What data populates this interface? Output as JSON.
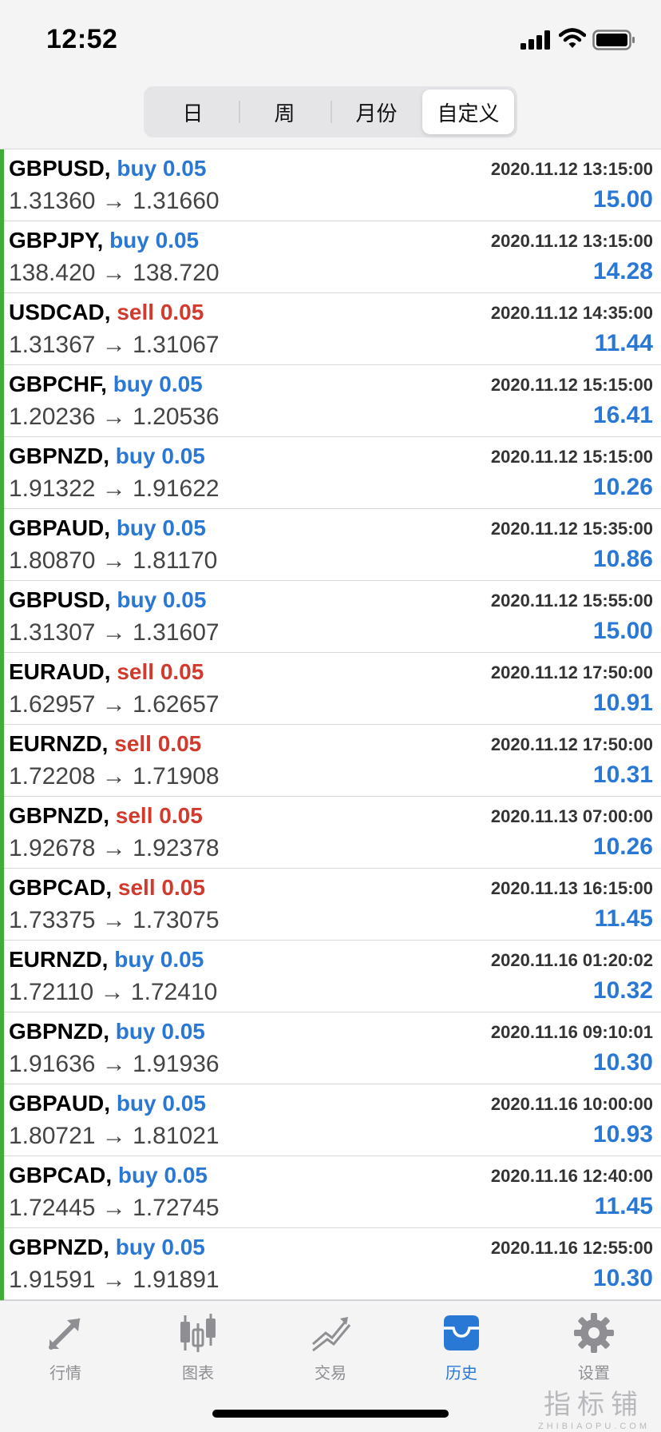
{
  "status": {
    "time": "12:52"
  },
  "segments": [
    {
      "label": "日",
      "active": false
    },
    {
      "label": "周",
      "active": false
    },
    {
      "label": "月份",
      "active": false
    },
    {
      "label": "自定义",
      "active": true
    }
  ],
  "trades": [
    {
      "symbol": "GBPUSD,",
      "side": "buy",
      "volume": "0.05",
      "open": "1.31360",
      "close": "1.31660",
      "time": "2020.11.12 13:15:00",
      "profit": "15.00"
    },
    {
      "symbol": "GBPJPY,",
      "side": "buy",
      "volume": "0.05",
      "open": "138.420",
      "close": "138.720",
      "time": "2020.11.12 13:15:00",
      "profit": "14.28"
    },
    {
      "symbol": "USDCAD,",
      "side": "sell",
      "volume": "0.05",
      "open": "1.31367",
      "close": "1.31067",
      "time": "2020.11.12 14:35:00",
      "profit": "11.44"
    },
    {
      "symbol": "GBPCHF,",
      "side": "buy",
      "volume": "0.05",
      "open": "1.20236",
      "close": "1.20536",
      "time": "2020.11.12 15:15:00",
      "profit": "16.41"
    },
    {
      "symbol": "GBPNZD,",
      "side": "buy",
      "volume": "0.05",
      "open": "1.91322",
      "close": "1.91622",
      "time": "2020.11.12 15:15:00",
      "profit": "10.26"
    },
    {
      "symbol": "GBPAUD,",
      "side": "buy",
      "volume": "0.05",
      "open": "1.80870",
      "close": "1.81170",
      "time": "2020.11.12 15:35:00",
      "profit": "10.86"
    },
    {
      "symbol": "GBPUSD,",
      "side": "buy",
      "volume": "0.05",
      "open": "1.31307",
      "close": "1.31607",
      "time": "2020.11.12 15:55:00",
      "profit": "15.00"
    },
    {
      "symbol": "EURAUD,",
      "side": "sell",
      "volume": "0.05",
      "open": "1.62957",
      "close": "1.62657",
      "time": "2020.11.12 17:50:00",
      "profit": "10.91"
    },
    {
      "symbol": "EURNZD,",
      "side": "sell",
      "volume": "0.05",
      "open": "1.72208",
      "close": "1.71908",
      "time": "2020.11.12 17:50:00",
      "profit": "10.31"
    },
    {
      "symbol": "GBPNZD,",
      "side": "sell",
      "volume": "0.05",
      "open": "1.92678",
      "close": "1.92378",
      "time": "2020.11.13 07:00:00",
      "profit": "10.26"
    },
    {
      "symbol": "GBPCAD,",
      "side": "sell",
      "volume": "0.05",
      "open": "1.73375",
      "close": "1.73075",
      "time": "2020.11.13 16:15:00",
      "profit": "11.45"
    },
    {
      "symbol": "EURNZD,",
      "side": "buy",
      "volume": "0.05",
      "open": "1.72110",
      "close": "1.72410",
      "time": "2020.11.16 01:20:02",
      "profit": "10.32"
    },
    {
      "symbol": "GBPNZD,",
      "side": "buy",
      "volume": "0.05",
      "open": "1.91636",
      "close": "1.91936",
      "time": "2020.11.16 09:10:01",
      "profit": "10.30"
    },
    {
      "symbol": "GBPAUD,",
      "side": "buy",
      "volume": "0.05",
      "open": "1.80721",
      "close": "1.81021",
      "time": "2020.11.16 10:00:00",
      "profit": "10.93"
    },
    {
      "symbol": "GBPCAD,",
      "side": "buy",
      "volume": "0.05",
      "open": "1.72445",
      "close": "1.72745",
      "time": "2020.11.16 12:40:00",
      "profit": "11.45"
    },
    {
      "symbol": "GBPNZD,",
      "side": "buy",
      "volume": "0.05",
      "open": "1.91591",
      "close": "1.91891",
      "time": "2020.11.16 12:55:00",
      "profit": "10.30"
    }
  ],
  "arrow": "→",
  "tabbar": {
    "quotes": {
      "label": "行情",
      "icon": "quotes-arrows-icon"
    },
    "chart": {
      "label": "图表",
      "icon": "candlestick-icon"
    },
    "trade": {
      "label": "交易",
      "icon": "trade-lines-icon"
    },
    "history": {
      "label": "历史",
      "icon": "inbox-tray-icon",
      "active": true
    },
    "settings": {
      "label": "设置",
      "icon": "gear-icon"
    }
  },
  "watermark": {
    "cn": "指标铺",
    "en": "ZHIBIAOPU.COM"
  },
  "colors": {
    "buy": "#2a78d6",
    "sell": "#d23a2e",
    "profit": "#2a78d6",
    "accent_bar": "#3fae36",
    "tab_active": "#2a78d6",
    "tab_inactive": "#8e8e93"
  }
}
